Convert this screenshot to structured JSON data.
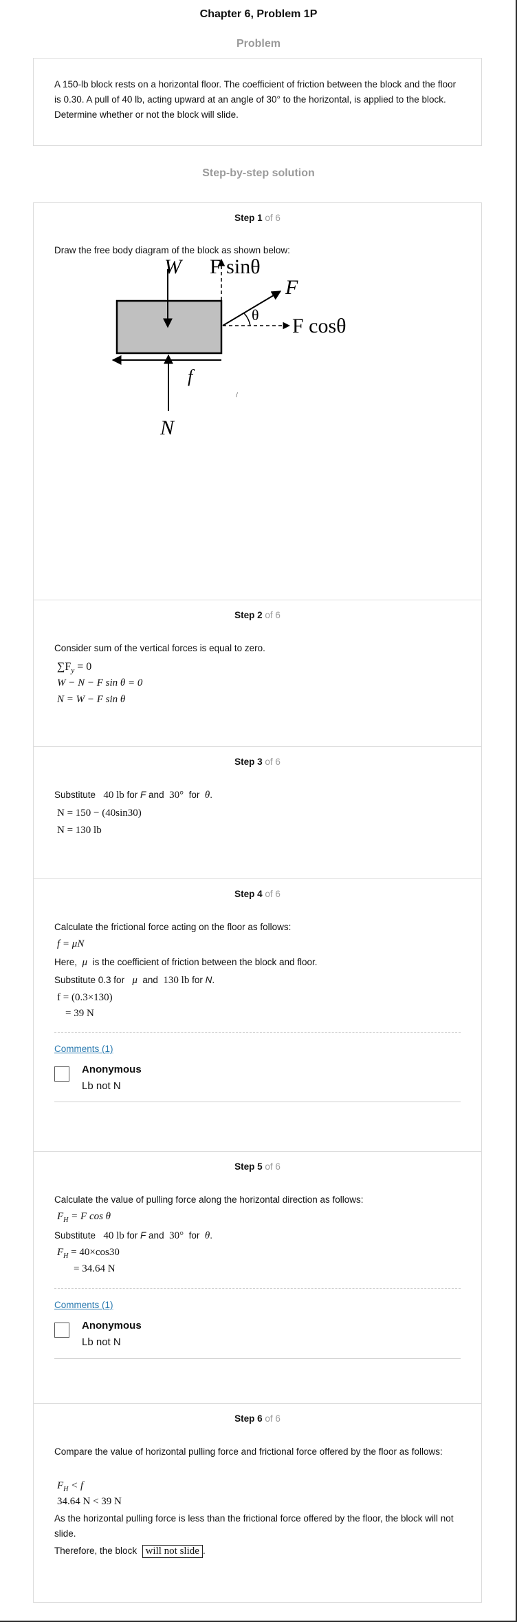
{
  "page": {
    "title": "Chapter 6, Problem 1P",
    "problem_heading": "Problem",
    "problem_text": "A 150-lb block rests on a horizontal floor. The coefficient of friction between the block and the floor is 0.30. A pull of 40 lb, acting upward at an angle of 30° to the horizontal, is applied to the block. Determine whether or not the block will slide.",
    "solution_heading": "Step-by-step solution"
  },
  "steps": [
    {
      "label": "Step 1",
      "of": " of 6",
      "text": "Draw the free body diagram of the block as shown below:",
      "diagram": {
        "W": "W",
        "F_sin": "F sinθ",
        "F": "F",
        "theta": "θ",
        "F_cos": "F cosθ",
        "f": "f",
        "N": "N",
        "mark": "/"
      }
    },
    {
      "label": "Step 2",
      "of": " of 6",
      "text": "Consider sum of the vertical forces is equal to zero.",
      "eq1": "∑F",
      "eq1_sub": "y",
      "eq1_rhs": " = 0",
      "eq2": "W − N − F sin θ = 0",
      "eq3": "N = W − F sin θ"
    },
    {
      "label": "Step 3",
      "of": " of 6",
      "sub_word": "Substitute",
      "v1": "40 lb",
      "for": "for",
      "F": "F",
      "and": "and",
      "v2": "30°",
      "theta": "θ",
      "eq1": "N = 150 − (40sin30)",
      "eq2": "N = 130 lb"
    },
    {
      "label": "Step 4",
      "of": " of 6",
      "text1": "Calculate the frictional force acting on the floor as follows:",
      "eq1": "f = μN",
      "here": "Here,",
      "mu": "μ",
      "here_rest": "is the coefficient of friction between the block and floor.",
      "sub_word": "Substitute 0.3 for",
      "v2": "130 lb",
      "for": "for",
      "N": "N",
      "and": "and",
      "eq2": "f = (0.3×130)",
      "eq3": "= 39 N",
      "comments_link": "Comments (1)",
      "comment_author": "Anonymous",
      "comment_text": "Lb not N"
    },
    {
      "label": "Step 5",
      "of": " of 6",
      "text1": "Calculate the value of pulling force along the horizontal direction as follows:",
      "eq1_F": "F",
      "eq1_sub": "H",
      "eq1_rhs": " = F cos θ",
      "sub_word": "Substitute",
      "v1": "40 lb",
      "for": "for",
      "F": "F",
      "and": "and",
      "v2": "30°",
      "theta": "θ",
      "eq2": " = 40×cos30",
      "eq3": "= 34.64 N",
      "comments_link": "Comments (1)",
      "comment_author": "Anonymous",
      "comment_text": "Lb not N"
    },
    {
      "label": "Step 6",
      "of": " of 6",
      "text1": "Compare the value of horizontal pulling force and frictional force offered by the floor as follows:",
      "eq1_rhs": " < f",
      "eq2": "34.64 N < 39 N",
      "text2": "As the horizontal pulling force is less than the frictional force offered by the floor, the block will not slide.",
      "text3": "Therefore, the block",
      "answer": "will not slide",
      "end": "."
    }
  ]
}
